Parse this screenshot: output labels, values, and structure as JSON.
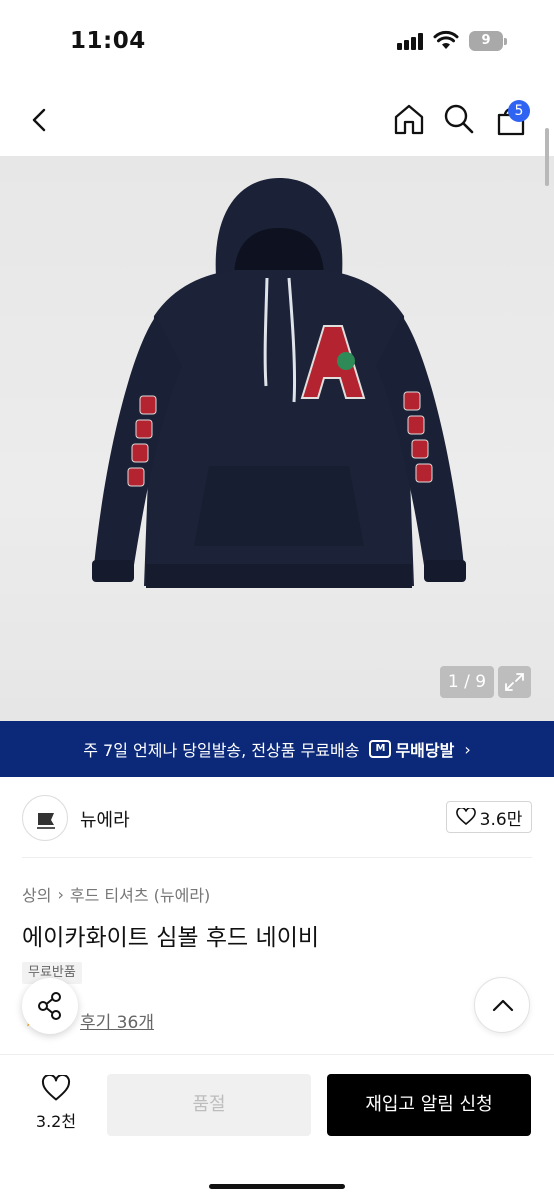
{
  "status_bar": {
    "time": "11:04",
    "battery": "9"
  },
  "nav": {
    "cart_count": "5"
  },
  "gallery": {
    "counter": "1 / 9"
  },
  "promo": {
    "text": "주 7일 언제나 당일발송, 전상품 무료배송",
    "logo_mark": "M",
    "logo_text": "무배당발",
    "chevron": "›"
  },
  "brand": {
    "name": "뉴에라",
    "likes": "3.6만"
  },
  "breadcrumb": {
    "items": [
      "상의",
      "후드 티셔츠 (뉴에라)"
    ],
    "separator": "›"
  },
  "product": {
    "title": "에이카화이트 심볼 후드 네이비",
    "tag": "무료반품",
    "reviews": "후기 36개"
  },
  "bottom": {
    "wish_count": "3.2천",
    "soldout_label": "품절",
    "restock_label": "재입고 알림 신청"
  },
  "colors": {
    "promo_bg": "#0b2879",
    "badge": "#2f63f2",
    "hoodie": "#1c2238",
    "logo_red": "#b32430"
  }
}
